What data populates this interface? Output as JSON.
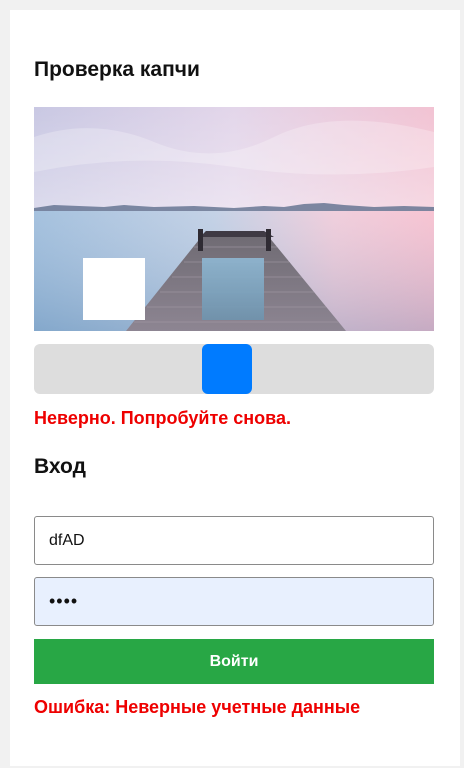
{
  "captcha": {
    "title": "Проверка капчи",
    "error": "Неверно. Попробуйте снова.",
    "slider_position": 0.4
  },
  "login": {
    "title": "Вход",
    "username_value": "dfAD",
    "password_value": "dfAD",
    "button_label": "Войти",
    "error": "Ошибка: Неверные учетные данные"
  },
  "colors": {
    "slider_handle": "#007bff",
    "slider_track": "#dddddd",
    "button": "#28a745",
    "error": "#ee0000",
    "password_bg": "#e8f0fe"
  }
}
